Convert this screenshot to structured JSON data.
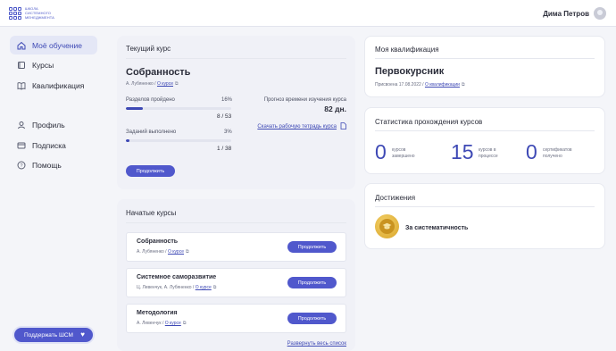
{
  "header": {
    "logo_text": "Школа системного менеджмента",
    "user_name": "Дима Петров"
  },
  "sidebar": {
    "items": [
      {
        "label": "Моё обучение",
        "icon": "home-icon",
        "active": true
      },
      {
        "label": "Курсы",
        "icon": "book-icon",
        "active": false
      },
      {
        "label": "Квалификация",
        "icon": "book-open-icon",
        "active": false
      },
      {
        "label": "Профиль",
        "icon": "user-icon",
        "active": false
      },
      {
        "label": "Подписка",
        "icon": "card-icon",
        "active": false
      },
      {
        "label": "Помощь",
        "icon": "help-icon",
        "active": false
      }
    ],
    "support_label": "Поддержать ШСМ"
  },
  "current_course": {
    "section_title": "Текущий курс",
    "name": "Собранность",
    "author": "А. Лубяненко /",
    "about_link": "О курсе",
    "sections_label": "Разделов пройдено",
    "sections_pct": "16%",
    "sections_fraction": 0.16,
    "sections_count": "8 / 53",
    "tasks_label": "Заданий выполнено",
    "tasks_pct": "3%",
    "tasks_fraction": 0.03,
    "tasks_count": "1 / 38",
    "forecast_label": "Прогноз времени изучения курса",
    "forecast_value": "82 дн.",
    "download_label": "Скачать рабочую тетрадь курса",
    "continue_label": "Продолжить"
  },
  "started_courses": {
    "section_title": "Начатые курсы",
    "items": [
      {
        "title": "Собранность",
        "authors": "А. Лубяненко /",
        "link": "О курсе",
        "button": "Продолжить"
      },
      {
        "title": "Системное саморазвитие",
        "authors": "Ц. Левенчук, А. Лубяненко /",
        "link": "О курсе",
        "button": "Продолжить"
      },
      {
        "title": "Методология",
        "authors": "А. Левенчук /",
        "link": "О курсе",
        "button": "Продолжить"
      }
    ],
    "expand_label": "Развернуть весь список"
  },
  "qualification": {
    "section_title": "Моя квалификация",
    "name": "Первокурсник",
    "assigned": "Присвоена 17.08.2022 /",
    "link": "О квалификации"
  },
  "stats": {
    "section_title": "Статистика прохождения курсов",
    "completed_value": "0",
    "completed_caption": "курсов завершено",
    "in_progress_value": "15",
    "in_progress_caption": "курсов в процессе",
    "certs_value": "0",
    "certs_caption": "сертификатов получено"
  },
  "achievements": {
    "section_title": "Достижения",
    "item_label": "За систематичность",
    "icon": "medal-icon"
  },
  "colors": {
    "accent": "#3e49b5",
    "button": "#5058cc",
    "medal": "#d9a52a"
  }
}
